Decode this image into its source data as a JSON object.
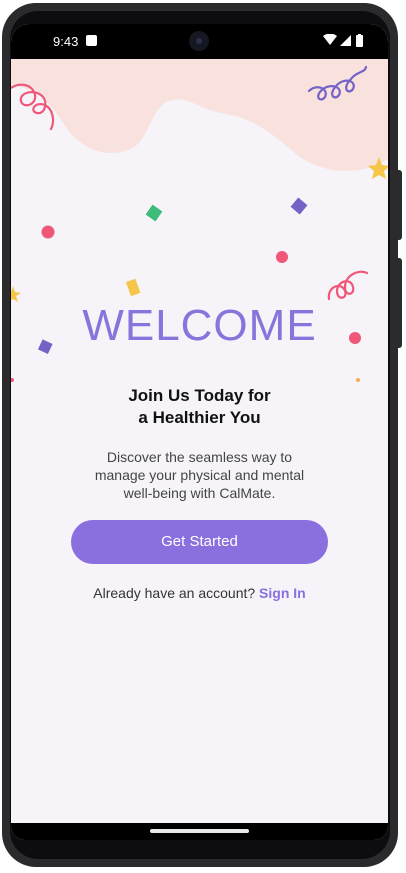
{
  "status_bar": {
    "time": "9:43",
    "icons": [
      "android-notification-icon",
      "wifi-icon",
      "signal-icon",
      "battery-icon"
    ]
  },
  "welcome": {
    "title": "WELCOME",
    "subtitle_line1": "Join Us Today for",
    "subtitle_line2": "a Healthier You",
    "description_line1": "Discover the seamless way to",
    "description_line2": "manage your physical and mental",
    "description_line3": "well-being with CalMate.",
    "get_started_label": "Get Started",
    "account_prompt": "Already have an account?",
    "sign_in_label": "Sign In"
  },
  "colors": {
    "accent": "#8a6fdf",
    "title": "#8a74dc",
    "blob": "#f9e1de",
    "background": "#f6f4f8",
    "confetti_pink": "#f0587a",
    "confetti_green": "#3dbb79",
    "confetti_purple": "#7462c6",
    "confetti_yellow": "#f5c64a"
  }
}
